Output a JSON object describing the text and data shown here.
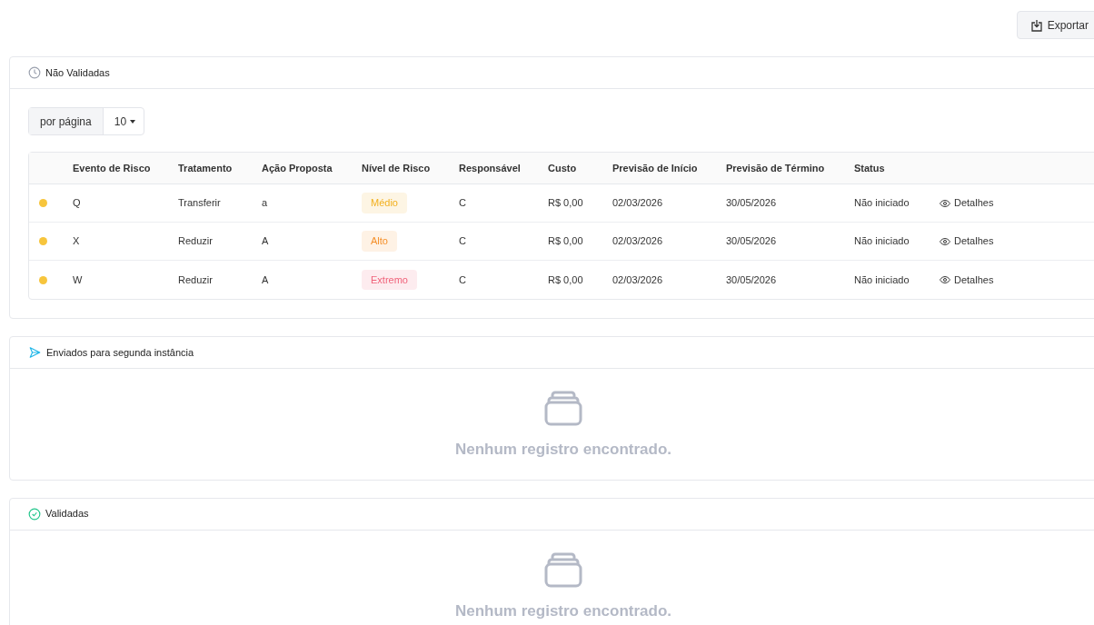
{
  "export_button": {
    "label": "Exportar"
  },
  "sections": [
    {
      "title": "Não Validadas",
      "kind": "clock",
      "per_page": {
        "label": "por página",
        "value": "10"
      },
      "columns": [
        "Evento de Risco",
        "Tratamento",
        "Ação Proposta",
        "Nível de Risco",
        "Responsável",
        "Custo",
        "Previsão de Início",
        "Previsão de Término",
        "Status"
      ],
      "rows": [
        {
          "color": "#f7c53c",
          "event": "Q",
          "treatment": "Transferir",
          "action": "a",
          "risk": {
            "text": "Médio",
            "color": "#f2b01e"
          },
          "owner": "C",
          "cost": "R$ 0,00",
          "start": "02/03/2026",
          "end": "30/05/2026",
          "status": "Não iniciado",
          "details": "Detalhes"
        },
        {
          "color": "#f7c53c",
          "event": "X",
          "treatment": "Reduzir",
          "action": "A",
          "risk": {
            "text": "Alto",
            "color": "#f5902a"
          },
          "owner": "C",
          "cost": "R$ 0,00",
          "start": "02/03/2026",
          "end": "30/05/2026",
          "status": "Não iniciado",
          "details": "Detalhes"
        },
        {
          "color": "#f7c53c",
          "event": "W",
          "treatment": "Reduzir",
          "action": "A",
          "risk": {
            "text": "Extremo",
            "color": "#f0627a"
          },
          "owner": "C",
          "cost": "R$ 0,00",
          "start": "02/03/2026",
          "end": "30/05/2026",
          "status": "Não iniciado",
          "details": "Detalhes"
        }
      ]
    },
    {
      "title": "Enviados para segunda instância",
      "kind": "send",
      "message": "Nenhum registro encontrado."
    },
    {
      "title": "Validadas",
      "kind": "check",
      "message": "Nenhum registro encontrado."
    }
  ]
}
